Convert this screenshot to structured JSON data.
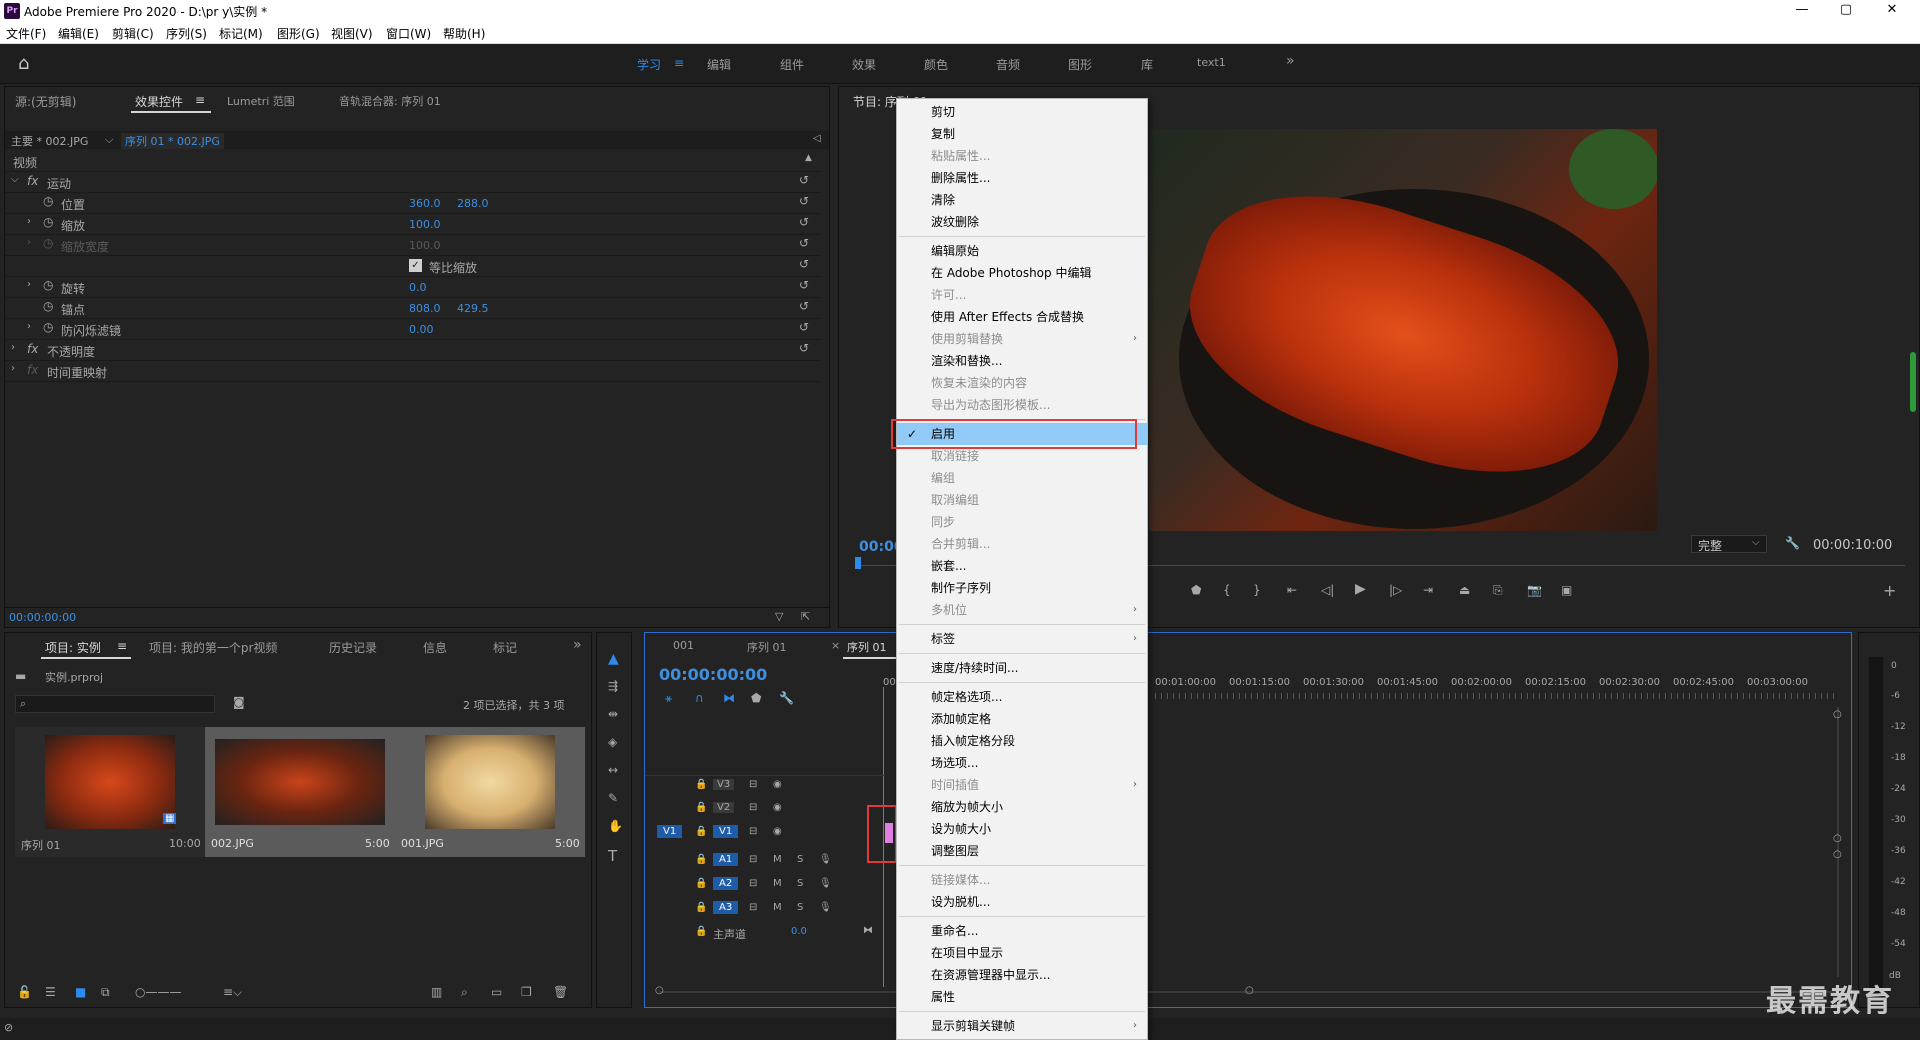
{
  "titlebar": {
    "logo": "Pr",
    "title": "Adobe Premiere Pro 2020 - D:\\pr y\\实例 *",
    "minimize": "—",
    "maximize": "▢",
    "close": "✕"
  },
  "menubar": [
    "文件(F)",
    "编辑(E)",
    "剪辑(C)",
    "序列(S)",
    "标记(M)",
    "图形(G)",
    "视图(V)",
    "窗口(W)",
    "帮助(H)"
  ],
  "workspaces": {
    "items": [
      "学习",
      "编辑",
      "组件",
      "效果",
      "颜色",
      "音频",
      "图形",
      "库",
      "text1"
    ],
    "active_index": 0,
    "more": "»"
  },
  "effect_panel": {
    "tabs": [
      "源:(无剪辑)",
      "效果控件",
      "Lumetri 范围",
      "音轨混合器: 序列 01"
    ],
    "active_tab": "效果控件",
    "master_label": "主要 * 002.JPG",
    "sequence_label": "序列 01 * 002.JPG",
    "section": "视频",
    "fx": "fx",
    "motion": "运动",
    "position_label": "位置",
    "position_x": "360.0",
    "position_y": "288.0",
    "scale_label": "缩放",
    "scale_value": "100.0",
    "scale_width_label": "缩放宽度",
    "scale_width_value": "100.0",
    "uniform_scale_label": "等比缩放",
    "rotation_label": "旋转",
    "rotation_value": "0.0",
    "anchor_label": "锚点",
    "anchor_x": "808.0",
    "anchor_y": "429.5",
    "antiflicker_label": "防闪烁滤镜",
    "antiflicker_value": "0.00",
    "opacity_label": "不透明度",
    "time_remap_label": "时间重映射",
    "timecode": "00:00:00:00"
  },
  "program_monitor": {
    "title": "节目: 序列 01",
    "timecode_left": "00:00",
    "quality": "完整",
    "duration": "00:00:10:00"
  },
  "project_panel": {
    "tabs": [
      "项目: 实例",
      "项目: 我的第一个pr视频",
      "历史记录",
      "信息",
      "标记"
    ],
    "active_tab": "项目: 实例",
    "project_file": "实例.prproj",
    "selection_info": "2 项已选择，共 3 项",
    "items": [
      {
        "name": "序列 01",
        "duration": "10:00"
      },
      {
        "name": "002.JPG",
        "duration": "5:00"
      },
      {
        "name": "001.JPG",
        "duration": "5:00"
      }
    ]
  },
  "timeline": {
    "tabs": [
      "001",
      "序列 01",
      "序列 01"
    ],
    "timecode": "00:00:00:00",
    "ruler": [
      "00:00",
      "00:01:00:00",
      "00:01:15:00",
      "00:01:30:00",
      "00:01:45:00",
      "00:02:00:00",
      "00:02:15:00",
      "00:02:30:00",
      "00:02:45:00",
      "00:03:00:00"
    ],
    "video_tracks": [
      "V3",
      "V2",
      "V1"
    ],
    "audio_tracks": [
      "A1",
      "A2",
      "A3"
    ],
    "source_v1": "V1",
    "master_label": "主声道",
    "master_value": "0.0",
    "m": "M",
    "s": "S"
  },
  "audio_meter": {
    "labels": [
      "0",
      "-6",
      "-12",
      "-18",
      "-24",
      "-30",
      "-36",
      "-42",
      "-48",
      "-54",
      "dB"
    ]
  },
  "context_menu": {
    "items": [
      {
        "label": "剪切",
        "disabled": false
      },
      {
        "label": "复制",
        "disabled": false
      },
      {
        "label": "粘贴属性...",
        "disabled": true
      },
      {
        "label": "删除属性...",
        "disabled": false
      },
      {
        "label": "清除",
        "disabled": false
      },
      {
        "label": "波纹删除",
        "disabled": false
      },
      {
        "sep": true
      },
      {
        "label": "编辑原始",
        "disabled": false
      },
      {
        "label": "在 Adobe Photoshop 中编辑",
        "disabled": false
      },
      {
        "label": "许可...",
        "disabled": true
      },
      {
        "label": "使用 After Effects 合成替换",
        "disabled": false
      },
      {
        "label": "使用剪辑替换",
        "disabled": true,
        "submenu": true
      },
      {
        "label": "渲染和替换...",
        "disabled": false
      },
      {
        "label": "恢复未渲染的内容",
        "disabled": true
      },
      {
        "label": "导出为动态图形模板...",
        "disabled": true
      },
      {
        "sep": true
      },
      {
        "label": "启用",
        "disabled": false,
        "checked": true,
        "highlight": true
      },
      {
        "label": "取消链接",
        "disabled": true
      },
      {
        "label": "编组",
        "disabled": true
      },
      {
        "label": "取消编组",
        "disabled": true
      },
      {
        "label": "同步",
        "disabled": true
      },
      {
        "label": "合并剪辑...",
        "disabled": true
      },
      {
        "label": "嵌套...",
        "disabled": false
      },
      {
        "label": "制作子序列",
        "disabled": false
      },
      {
        "label": "多机位",
        "disabled": true,
        "submenu": true
      },
      {
        "sep": true
      },
      {
        "label": "标签",
        "disabled": false,
        "submenu": true
      },
      {
        "sep": true
      },
      {
        "label": "速度/持续时间...",
        "disabled": false
      },
      {
        "sep": true
      },
      {
        "label": "帧定格选项...",
        "disabled": false
      },
      {
        "label": "添加帧定格",
        "disabled": false
      },
      {
        "label": "插入帧定格分段",
        "disabled": false
      },
      {
        "label": "场选项...",
        "disabled": false
      },
      {
        "label": "时间插值",
        "disabled": true,
        "submenu": true
      },
      {
        "label": "缩放为帧大小",
        "disabled": false
      },
      {
        "label": "设为帧大小",
        "disabled": false
      },
      {
        "label": "调整图层",
        "disabled": false
      },
      {
        "sep": true
      },
      {
        "label": "链接媒体...",
        "disabled": true
      },
      {
        "label": "设为脱机...",
        "disabled": false
      },
      {
        "sep": true
      },
      {
        "label": "重命名...",
        "disabled": false
      },
      {
        "label": "在项目中显示",
        "disabled": false
      },
      {
        "label": "在资源管理器中显示...",
        "disabled": false
      },
      {
        "label": "属性",
        "disabled": false
      },
      {
        "sep": true
      },
      {
        "label": "显示剪辑关键帧",
        "disabled": false,
        "submenu": true
      }
    ]
  },
  "watermark": "最需教育",
  "colors": {
    "accent": "#2d8ceb",
    "highlight": "#91c9f7",
    "red_box": "#e03a3a",
    "clip_pink": "#e080e0"
  }
}
